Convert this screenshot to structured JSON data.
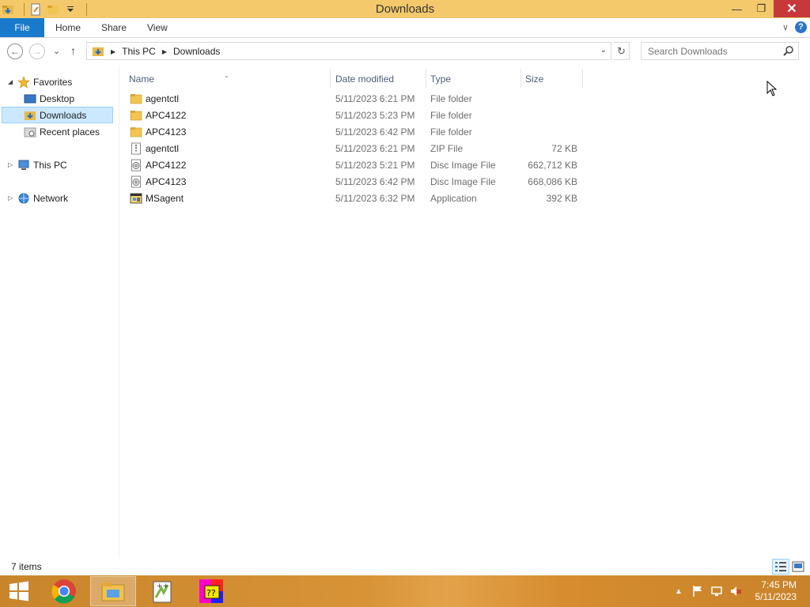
{
  "window": {
    "title": "Downloads",
    "minimize_glyph": "—",
    "maximize_glyph": "❐",
    "close_glyph": "✕"
  },
  "ribbon": {
    "tabs": [
      "File",
      "Home",
      "Share",
      "View"
    ],
    "help_glyph": "?",
    "expand_glyph": "∨"
  },
  "address_bar": {
    "back_glyph": "←",
    "forward_glyph": "→",
    "recent_glyph": "⌄",
    "up_glyph": "↑",
    "crumbs": [
      "This PC",
      "Downloads"
    ],
    "dropdown_glyph": "⌄",
    "refresh_glyph": "↻",
    "search_placeholder": "Search Downloads"
  },
  "nav_pane": {
    "favorites": "Favorites",
    "desktop": "Desktop",
    "downloads": "Downloads",
    "recent_places": "Recent places",
    "this_pc": "This PC",
    "network": "Network"
  },
  "columns": {
    "name": "Name",
    "date_modified": "Date modified",
    "type": "Type",
    "size": "Size"
  },
  "files": [
    {
      "name": "agentctl",
      "date": "5/11/2023 6:21 PM",
      "type": "File folder",
      "size": "",
      "icon": "folder-icon"
    },
    {
      "name": "APC4122",
      "date": "5/11/2023 5:23 PM",
      "type": "File folder",
      "size": "",
      "icon": "folder-icon"
    },
    {
      "name": "APC4123",
      "date": "5/11/2023 6:42 PM",
      "type": "File folder",
      "size": "",
      "icon": "folder-icon"
    },
    {
      "name": "agentctl",
      "date": "5/11/2023 6:21 PM",
      "type": "ZIP File",
      "size": "72 KB",
      "icon": "zip-file-icon"
    },
    {
      "name": "APC4122",
      "date": "5/11/2023 5:21 PM",
      "type": "Disc Image File",
      "size": "662,712 KB",
      "icon": "disc-image-icon"
    },
    {
      "name": "APC4123",
      "date": "5/11/2023 6:42 PM",
      "type": "Disc Image File",
      "size": "668,086 KB",
      "icon": "disc-image-icon"
    },
    {
      "name": "MSagent",
      "date": "5/11/2023 6:32 PM",
      "type": "Application",
      "size": "392 KB",
      "icon": "application-icon"
    }
  ],
  "status": {
    "item_count": "7 items"
  },
  "taskbar": {
    "apps": [
      "start-button",
      "chrome-icon",
      "file-explorer-icon",
      "notepad-plus-plus-icon",
      "unknown-app-icon"
    ],
    "clock_time": "7:45 PM",
    "clock_date": "5/11/2023",
    "tray_glyph": "▲"
  },
  "colors": {
    "title_bar": "#f4c96b",
    "file_tab": "#1979ca",
    "selection": "#cce8ff",
    "close_button": "#c7383a"
  }
}
